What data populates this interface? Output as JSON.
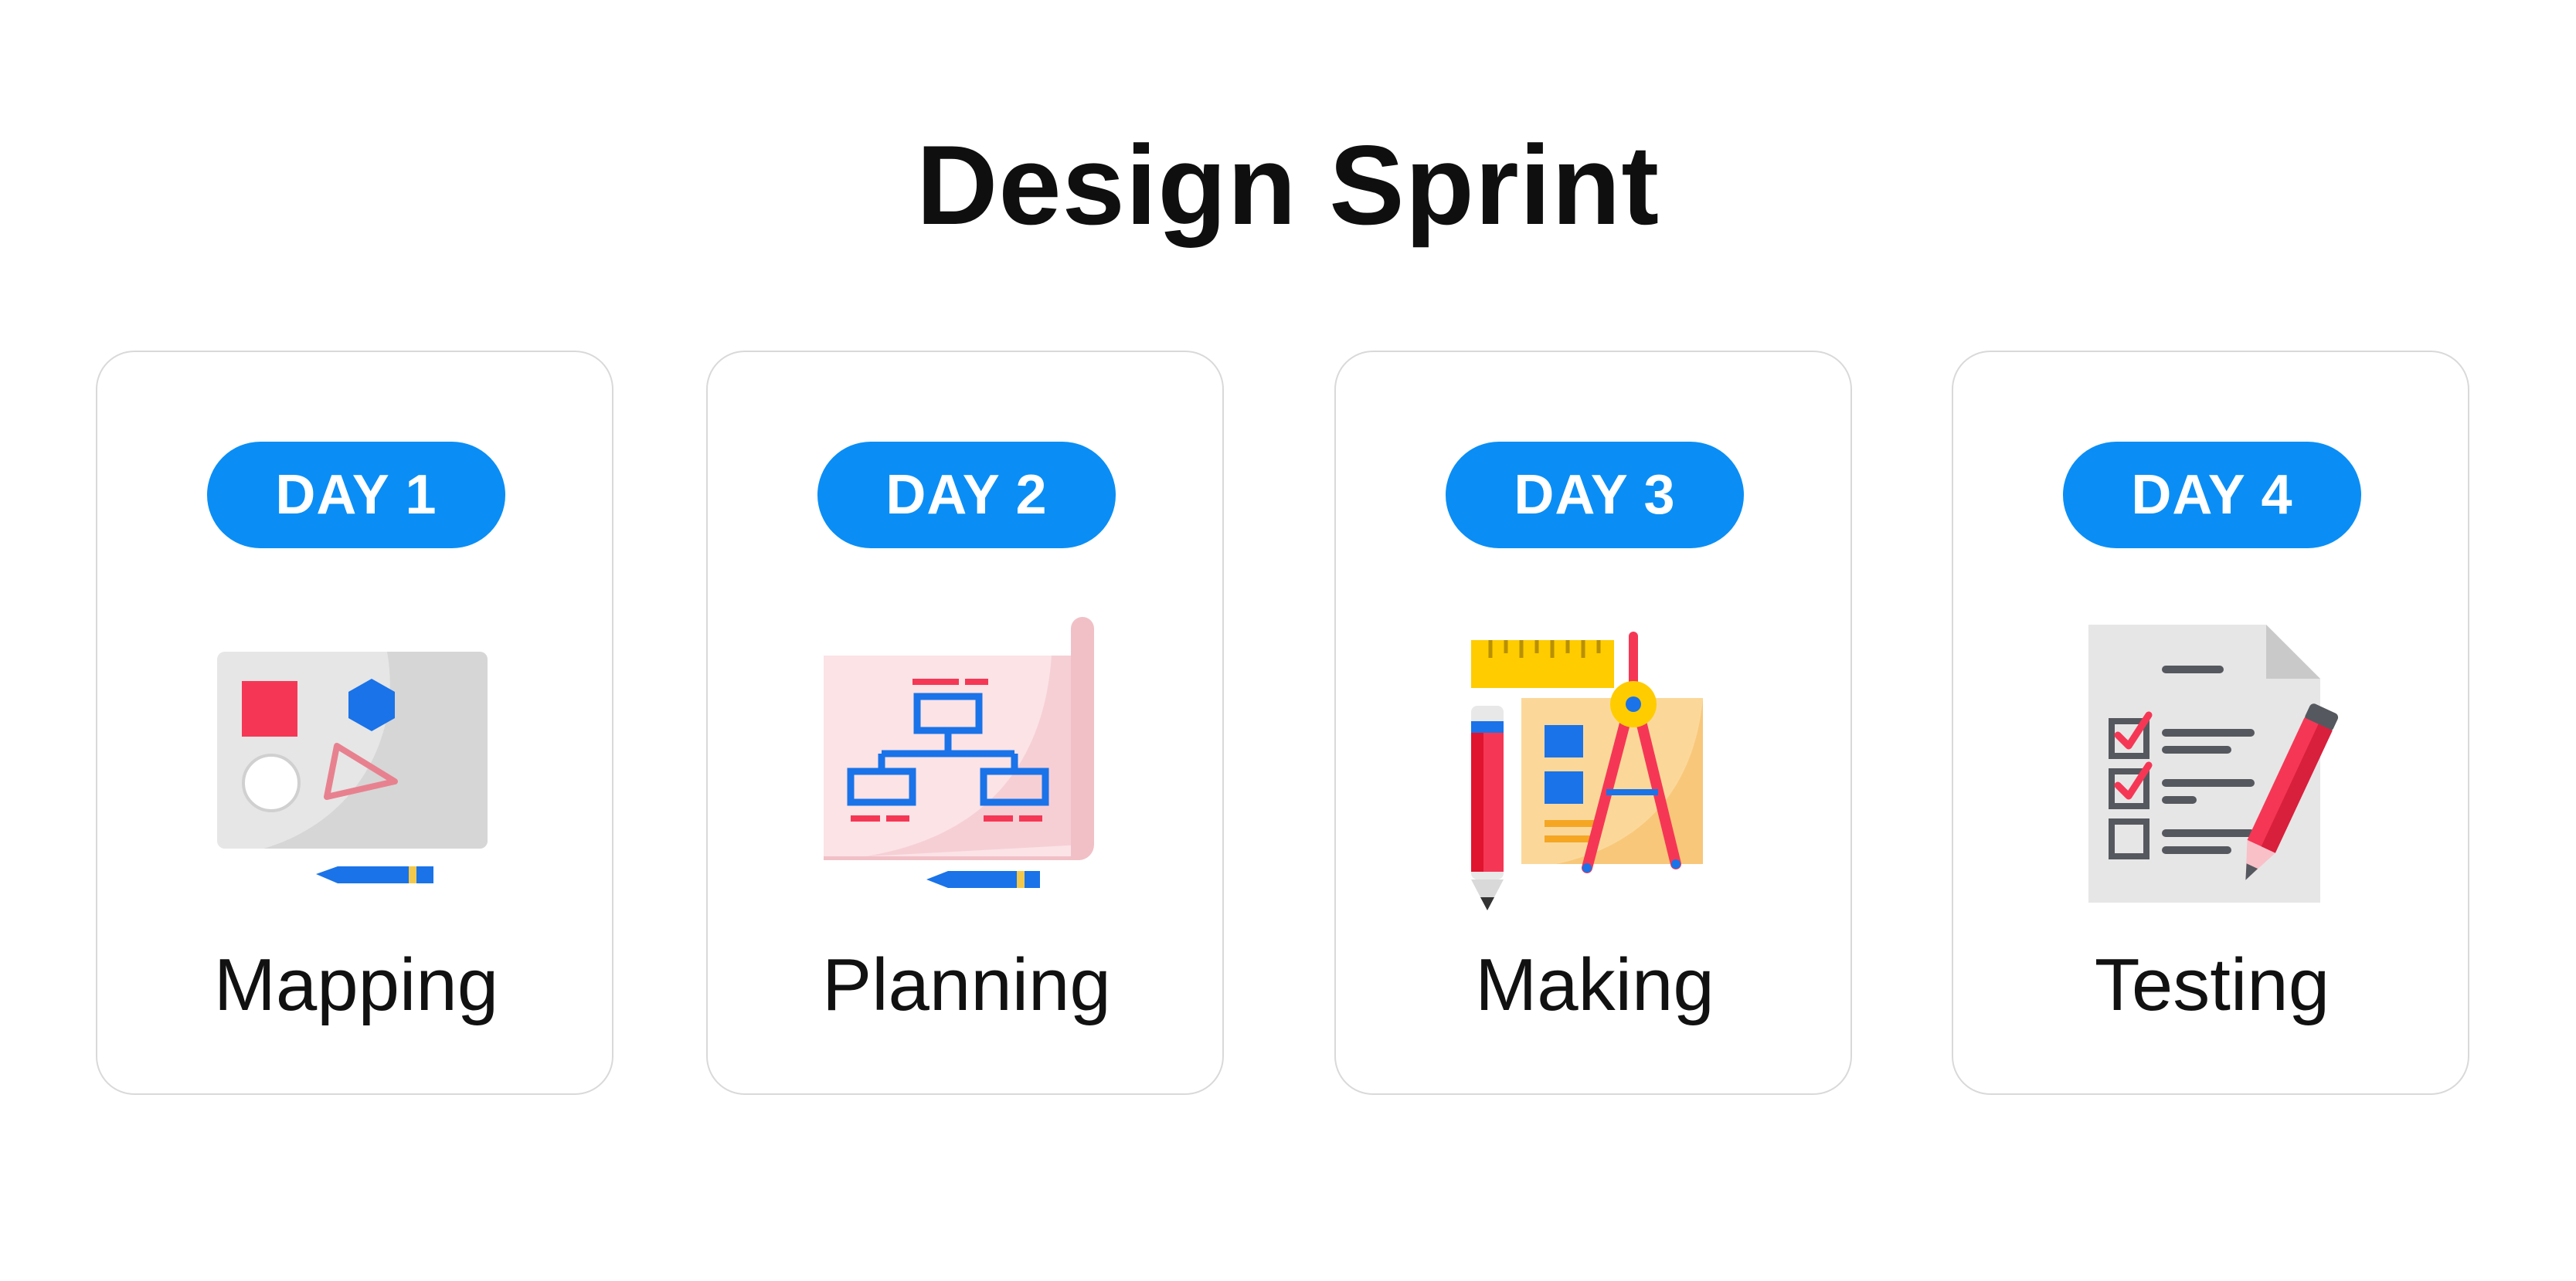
{
  "title": "Design Sprint",
  "colors": {
    "accent": "#0a8ef5",
    "card_border": "#d9d9d9",
    "text": "#111111"
  },
  "cards": [
    {
      "badge": "DAY 1",
      "label": "Mapping",
      "icon": "whiteboard-shapes-icon"
    },
    {
      "badge": "DAY 2",
      "label": "Planning",
      "icon": "blueprint-flowchart-icon"
    },
    {
      "badge": "DAY 3",
      "label": "Making",
      "icon": "ruler-compass-pencil-icon"
    },
    {
      "badge": "DAY 4",
      "label": "Testing",
      "icon": "checklist-pen-icon"
    }
  ]
}
